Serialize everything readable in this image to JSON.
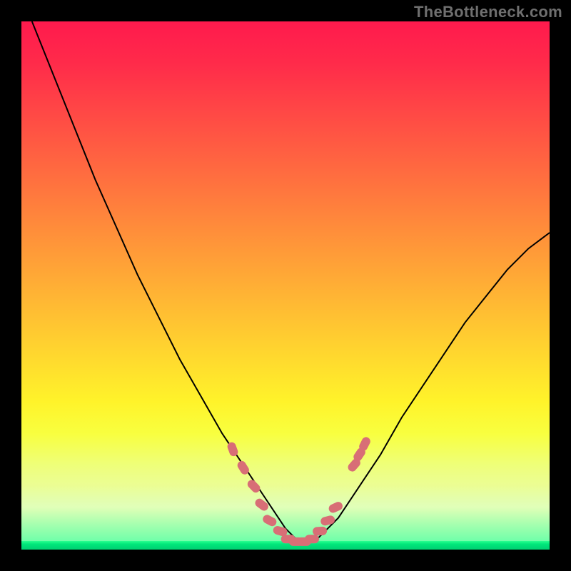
{
  "watermark": "TheBottleneck.com",
  "chart_data": {
    "type": "line",
    "title": "",
    "xlabel": "",
    "ylabel": "",
    "xlim": [
      0,
      100
    ],
    "ylim": [
      0,
      100
    ],
    "grid": false,
    "legend": false,
    "series": [
      {
        "name": "bottleneck-curve",
        "x": [
          2,
          6,
          10,
          14,
          18,
          22,
          26,
          30,
          34,
          38,
          42,
          46,
          50,
          52,
          54,
          56,
          60,
          64,
          68,
          72,
          76,
          80,
          84,
          88,
          92,
          96,
          100
        ],
        "values": [
          100,
          90,
          80,
          70,
          61,
          52,
          44,
          36,
          29,
          22,
          16,
          10,
          4,
          2,
          1,
          2,
          6,
          12,
          18,
          25,
          31,
          37,
          43,
          48,
          53,
          57,
          60
        ]
      }
    ],
    "marker_groups": [
      {
        "name": "sweet-spot-markers",
        "color": "#d86e76",
        "points": [
          {
            "x": 40,
            "y": 19
          },
          {
            "x": 42,
            "y": 15.5
          },
          {
            "x": 44,
            "y": 12
          },
          {
            "x": 45.5,
            "y": 8.5
          },
          {
            "x": 47,
            "y": 5.5
          },
          {
            "x": 49,
            "y": 3.5
          },
          {
            "x": 50.5,
            "y": 2
          },
          {
            "x": 52,
            "y": 1.5
          },
          {
            "x": 53.5,
            "y": 1.5
          },
          {
            "x": 55,
            "y": 2
          },
          {
            "x": 56.5,
            "y": 3.5
          },
          {
            "x": 58,
            "y": 5.5
          },
          {
            "x": 59.5,
            "y": 8
          },
          {
            "x": 63,
            "y": 16
          },
          {
            "x": 64,
            "y": 18
          },
          {
            "x": 65,
            "y": 20
          }
        ]
      }
    ]
  }
}
